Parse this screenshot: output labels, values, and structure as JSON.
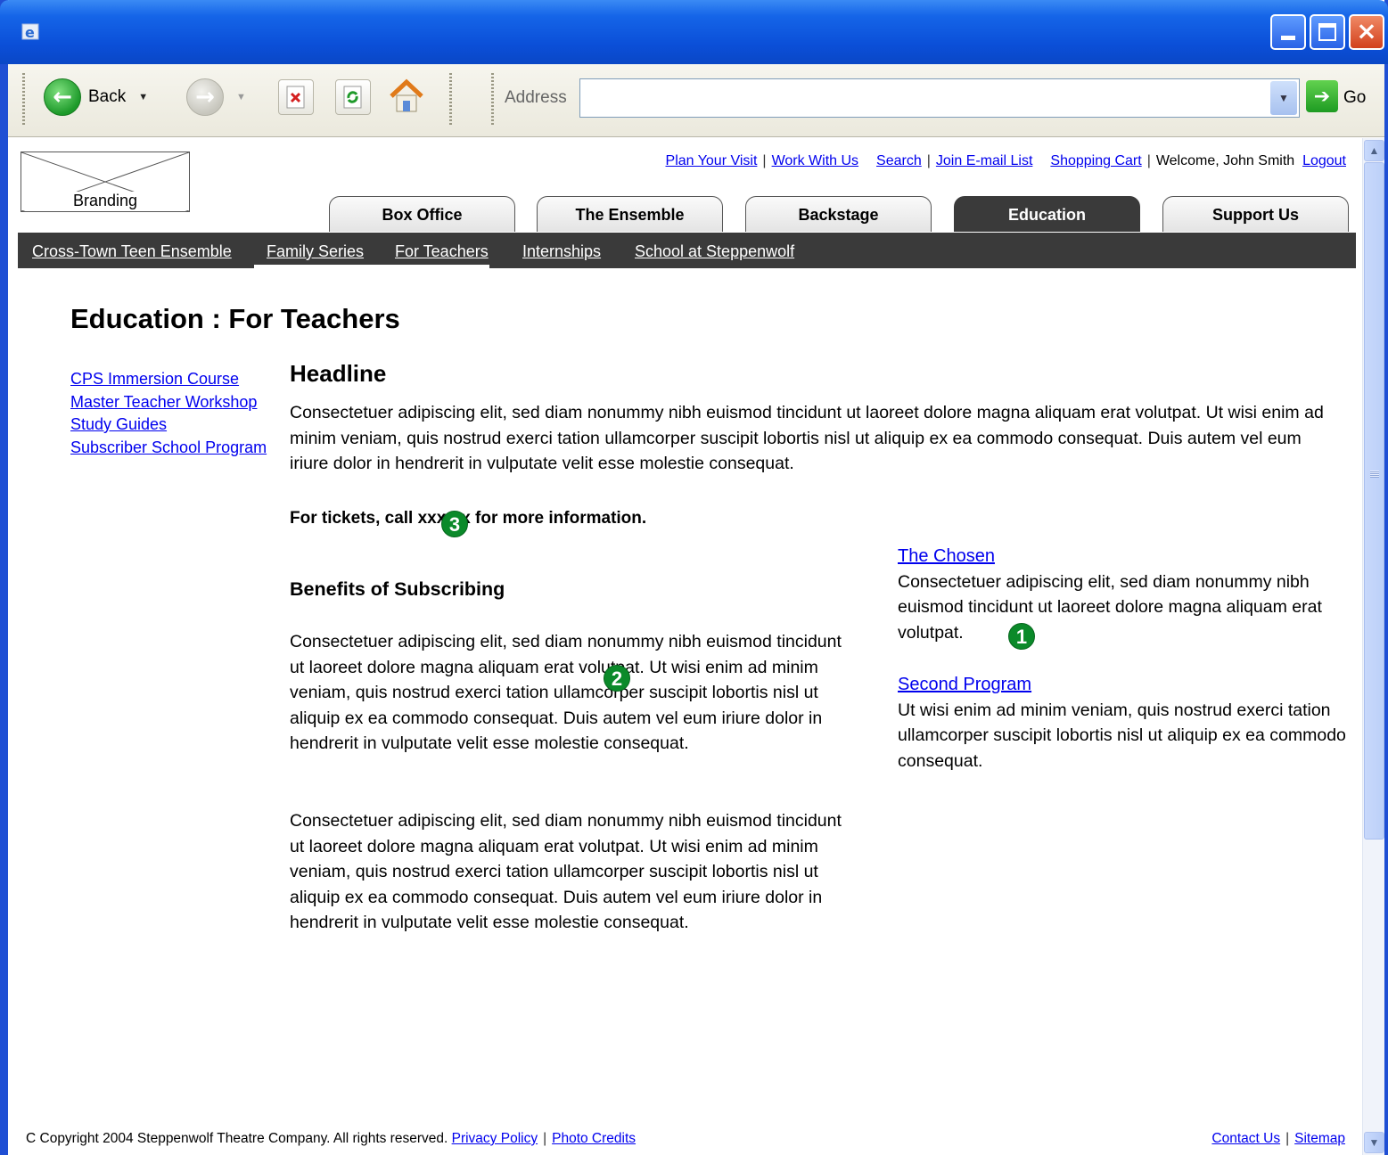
{
  "browser": {
    "toolbar": {
      "back_label": "Back",
      "address_label": "Address",
      "address_value": "",
      "go_label": "Go"
    }
  },
  "site": {
    "branding_label": "Branding",
    "utility_nav": {
      "plan_visit": "Plan Your Visit",
      "work_with_us": "Work With Us",
      "search": "Search",
      "join_email": "Join E-mail List",
      "shopping_cart": "Shopping Cart",
      "welcome": "Welcome, John Smith",
      "logout": "Logout"
    },
    "tabs": [
      "Box Office",
      "The Ensemble",
      "Backstage",
      "Education",
      "Support Us"
    ],
    "active_tab": "Education",
    "subnav": [
      "Cross-Town Teen Ensemble",
      "Family Series",
      "For Teachers",
      "Internships",
      "School at Steppenwolf"
    ],
    "active_subnav": "For Teachers"
  },
  "page": {
    "title": "Education : For Teachers",
    "left_nav": [
      "CPS Immersion Course",
      "Master Teacher Workshop",
      "Study Guides",
      "Subscriber School Program"
    ],
    "headline": "Headline",
    "intro": "Consectetuer adipiscing elit, sed diam nonummy nibh euismod tincidunt ut laoreet dolore magna aliquam erat volutpat. Ut wisi enim ad minim veniam, quis nostrud exerci tation ullamcorper suscipit lobortis nisl ut aliquip ex ea commodo consequat. Duis autem vel eum iriure dolor in hendrerit in vulputate velit esse molestie consequat.",
    "tickets_note": "For tickets, call xxx-xx for more information.",
    "benefits_heading": "Benefits of Subscribing",
    "benefits_paragraphs": [
      "Consectetuer adipiscing elit, sed diam nonummy nibh euismod tincidunt ut laoreet dolore magna aliquam erat volutpat. Ut wisi enim ad minim veniam, quis nostrud exerci tation ullamcorper suscipit lobortis nisl ut aliquip ex ea commodo consequat. Duis autem vel eum iriure dolor in hendrerit in vulputate velit esse molestie consequat.",
      "Consectetuer adipiscing elit, sed diam nonummy nibh euismod tincidunt ut laoreet dolore magna aliquam erat volutpat. Ut wisi enim ad minim veniam, quis nostrud exerci tation ullamcorper suscipit lobortis nisl ut aliquip ex ea commodo consequat. Duis autem vel eum iriure dolor in hendrerit in vulputate velit esse molestie consequat."
    ],
    "sidebar_programs": [
      {
        "title": "The Chosen",
        "text": "Consectetuer adipiscing elit, sed diam nonummy nibh euismod tincidunt ut laoreet dolore magna aliquam erat volutpat."
      },
      {
        "title": "Second Program",
        "text": "Ut wisi enim ad minim veniam, quis nostrud exerci tation ullamcorper suscipit lobortis nisl ut aliquip ex ea commodo consequat."
      }
    ],
    "callouts": [
      "1",
      "2",
      "3"
    ]
  },
  "footer": {
    "copyright": "C Copyright 2004 Steppenwolf Theatre Company. All rights reserved.",
    "privacy": "Privacy Policy",
    "photo_credits": "Photo Credits",
    "contact": "Contact Us",
    "sitemap": "Sitemap"
  },
  "colors": {
    "titlebar": "#0b4fd8",
    "nav_dark": "#3a3a3a",
    "link": "#0000ee",
    "callout": "#0b8a2a"
  }
}
